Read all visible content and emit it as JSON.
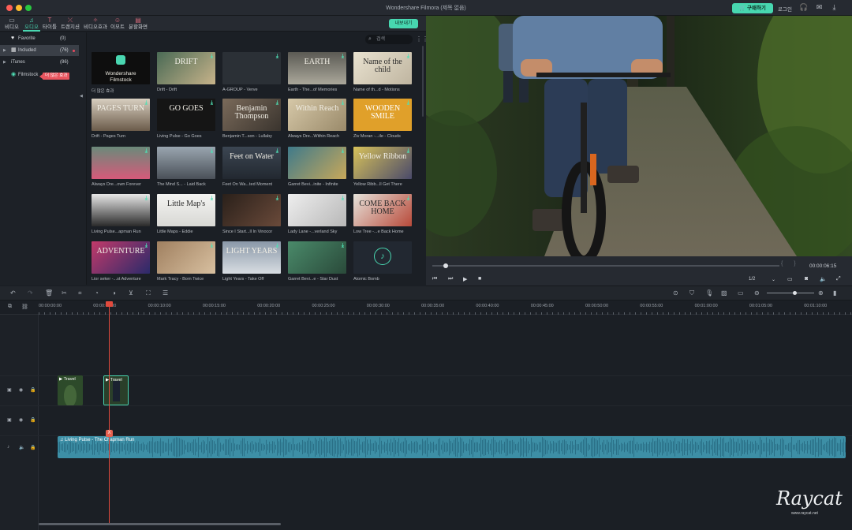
{
  "window": {
    "title": "Wondershare Filmora (제목 없음)",
    "buy_button": "구매하기",
    "login": "로그인",
    "colors": {
      "accent": "#47d7b0",
      "playhead": "#e14a3d",
      "audio_clip": "#3d8fa6",
      "tip": "#e8545e"
    }
  },
  "tabs": [
    {
      "label": "비디오",
      "icon": "folder-icon"
    },
    {
      "label": "오디오",
      "icon": "music-note-icon",
      "active": true
    },
    {
      "label": "타이틀",
      "icon": "title-t-icon"
    },
    {
      "label": "트랜지션",
      "icon": "transition-icon"
    },
    {
      "label": "비디오효과",
      "icon": "effects-icon"
    },
    {
      "label": "이모트",
      "icon": "element-icon"
    },
    {
      "label": "분할화면",
      "icon": "split-screen-icon"
    }
  ],
  "export_button": "내보내기",
  "library": {
    "items": [
      {
        "label": "Favorite",
        "count": "(0)",
        "icon": "heart-icon"
      },
      {
        "label": "Included",
        "count": "(76)",
        "icon": "grid-icon",
        "selected": true
      },
      {
        "label": "iTunes",
        "count": "(86)",
        "icon": ""
      },
      {
        "label": "Filmstock",
        "count": "",
        "icon": "filmstock-icon"
      }
    ],
    "tooltip": "더 많은 효과"
  },
  "search": {
    "placeholder": "검색"
  },
  "assets": [
    {
      "caption": "더 많은 효과",
      "thumb_text": "Wondershare Filmstock"
    },
    {
      "caption": "Drift - Drift",
      "thumb_text": "DRIFT"
    },
    {
      "caption": "A-GROUP - Verve",
      "thumb_text": ""
    },
    {
      "caption": "Earth - The...of Memories",
      "thumb_text": "EARTH"
    },
    {
      "caption": "Name of th...d - Motions",
      "thumb_text": "Name of the child"
    },
    {
      "caption": "Drift - Pages Turn",
      "thumb_text": "PAGES TURN"
    },
    {
      "caption": "Living Pulse - Go Goes",
      "thumb_text": "GO GOES"
    },
    {
      "caption": "Benjamin T...son - Lullaby",
      "thumb_text": "Benjamin Thompson"
    },
    {
      "caption": "Always Dre...Within Reach",
      "thumb_text": "Within Reach"
    },
    {
      "caption": "Ziv Moran -...ile - Clouds",
      "thumb_text": "WOODEN SMILE"
    },
    {
      "caption": "Always Dre...own Forever",
      "thumb_text": ""
    },
    {
      "caption": "The Mind S... - Laid Back",
      "thumb_text": ""
    },
    {
      "caption": "Feet On Wa...ted Moment",
      "thumb_text": "Feet on Water"
    },
    {
      "caption": "Garret Bevi...inite - Infinite",
      "thumb_text": ""
    },
    {
      "caption": "Yellow Ribb...ll Get There",
      "thumb_text": "Yellow Ribbon"
    },
    {
      "caption": "Living Pulse...apman Run",
      "thumb_text": ""
    },
    {
      "caption": "Little Maps - Eddie",
      "thumb_text": "Little Map's"
    },
    {
      "caption": "Since I Start...ll In Vinocor",
      "thumb_text": ""
    },
    {
      "caption": "Lady Lane -...verland Sky",
      "thumb_text": ""
    },
    {
      "caption": "Low Tree -...e Back Home",
      "thumb_text": "COME BACK HOME"
    },
    {
      "caption": "Lior seker -...st Adventure",
      "thumb_text": "ADVENTURE"
    },
    {
      "caption": "Mark Tracy - Born Twice",
      "thumb_text": ""
    },
    {
      "caption": "Light Years - Take Off",
      "thumb_text": "LIGHT YEARS"
    },
    {
      "caption": "Garret Bevi...e - Star Dust",
      "thumb_text": ""
    },
    {
      "caption": "Atomic Bomb",
      "thumb_text": ""
    }
  ],
  "preview": {
    "time": "00:00:06:15",
    "quality": "1/2",
    "brackets": "{ }"
  },
  "ruler": [
    "00:00:00:00",
    "00:00:05:00",
    "00:00:10:00",
    "00:00:15:00",
    "00:00:20:00",
    "00:00:25:00",
    "00:00:30:00",
    "00:00:35:00",
    "00:00:40:00",
    "00:00:45:00",
    "00:00:50:00",
    "00:00:55:00",
    "00:01:00:00",
    "00:01:05:00",
    "00:01:10:00"
  ],
  "timeline": {
    "clips": [
      {
        "label": "Travel"
      },
      {
        "label": "Travel"
      }
    ],
    "audio_label": "Living Pulse - The Chapman Run",
    "playhead_marker": "X"
  },
  "watermark": {
    "text": "Raycat",
    "sub": "www.raycat.net"
  }
}
